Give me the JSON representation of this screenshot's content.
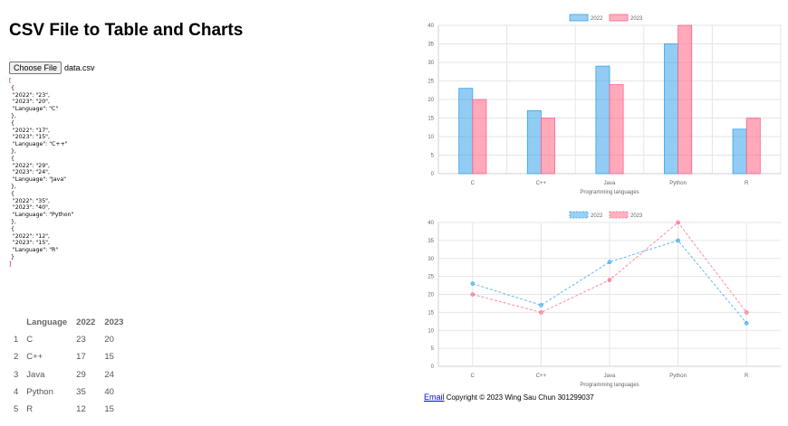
{
  "page": {
    "title": "CSV File to Table and Charts",
    "choose_file_label": "Choose File",
    "file_name": "data.csv"
  },
  "json_text": [
    {
      "2022": "23",
      "2023": "20",
      "Language": "C"
    },
    {
      "2022": "17",
      "2023": "15",
      "Language": "C++"
    },
    {
      "2022": "29",
      "2023": "24",
      "Language": "Java"
    },
    {
      "2022": "35",
      "2023": "40",
      "Language": "Python"
    },
    {
      "2022": "12",
      "2023": "15",
      "Language": "R"
    }
  ],
  "table": {
    "headers": [
      "Language",
      "2022",
      "2023"
    ],
    "rows": [
      {
        "index": "1",
        "language": "C",
        "y2022": "23",
        "y2023": "20"
      },
      {
        "index": "2",
        "language": "C++",
        "y2022": "17",
        "y2023": "15"
      },
      {
        "index": "3",
        "language": "Java",
        "y2022": "29",
        "y2023": "24"
      },
      {
        "index": "4",
        "language": "Python",
        "y2022": "35",
        "y2023": "40"
      },
      {
        "index": "5",
        "language": "R",
        "y2022": "12",
        "y2023": "15"
      }
    ]
  },
  "footer": {
    "email_label": "Email",
    "copyright": "Copyright © 2023 Wing Sau Chun 301299037"
  },
  "colors": {
    "series_2022": "#36a2eb",
    "series_2023": "#ff6384",
    "grid": "#e6e6e6",
    "json_bracket": "#c00000"
  },
  "chart_data": [
    {
      "type": "bar",
      "categories": [
        "C",
        "C++",
        "Java",
        "Python",
        "R"
      ],
      "series": [
        {
          "name": "2022",
          "values": [
            23,
            17,
            29,
            35,
            12
          ]
        },
        {
          "name": "2023",
          "values": [
            20,
            15,
            24,
            40,
            15
          ]
        }
      ],
      "title": "",
      "xlabel": "Programming languages",
      "ylabel": "",
      "ylim": [
        0,
        40
      ],
      "yticks": [
        0,
        5,
        10,
        15,
        20,
        25,
        30,
        35,
        40
      ],
      "legend": "top-center",
      "grid": true
    },
    {
      "type": "line",
      "categories": [
        "C",
        "C++",
        "Java",
        "Python",
        "R"
      ],
      "series": [
        {
          "name": "2022",
          "values": [
            23,
            17,
            29,
            35,
            12
          ]
        },
        {
          "name": "2023",
          "values": [
            20,
            15,
            24,
            40,
            15
          ]
        }
      ],
      "title": "",
      "xlabel": "Programming languages",
      "ylabel": "",
      "ylim": [
        0,
        40
      ],
      "yticks": [
        0,
        5,
        10,
        15,
        20,
        25,
        30,
        35,
        40
      ],
      "legend": "top-center",
      "grid": true,
      "line_style": "dashed"
    }
  ]
}
